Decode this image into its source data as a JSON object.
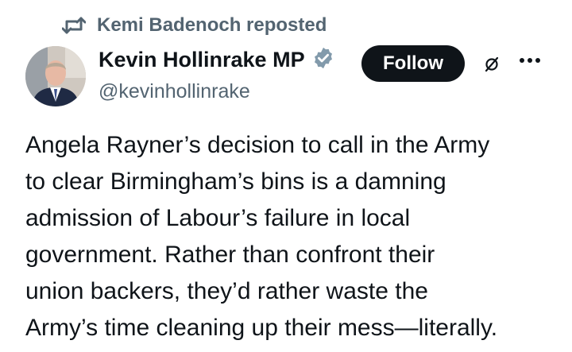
{
  "repost": {
    "label": "Kemi Badenoch reposted",
    "icon": "repost-icon"
  },
  "author": {
    "display_name": "Kevin Hollinrake MP",
    "handle": "@kevinhollinrake",
    "verified_icon": "verified-badge-icon",
    "verified_color": "#829aab"
  },
  "actions": {
    "follow_label": "Follow",
    "grok_icon": "grok-icon",
    "more_icon": "more-icon"
  },
  "tweet": {
    "lines": [
      "Angela Rayner’s decision to call in the Army",
      "to clear Birmingham’s bins is a damning",
      "admission of Labour’s failure in local",
      "government. Rather than confront their",
      "union backers, they’d rather waste the",
      "Army’s time cleaning up their mess—literally."
    ]
  },
  "colors": {
    "text": "#0f1419",
    "secondary": "#536471",
    "button_bg": "#0f1419",
    "button_text": "#ffffff"
  }
}
